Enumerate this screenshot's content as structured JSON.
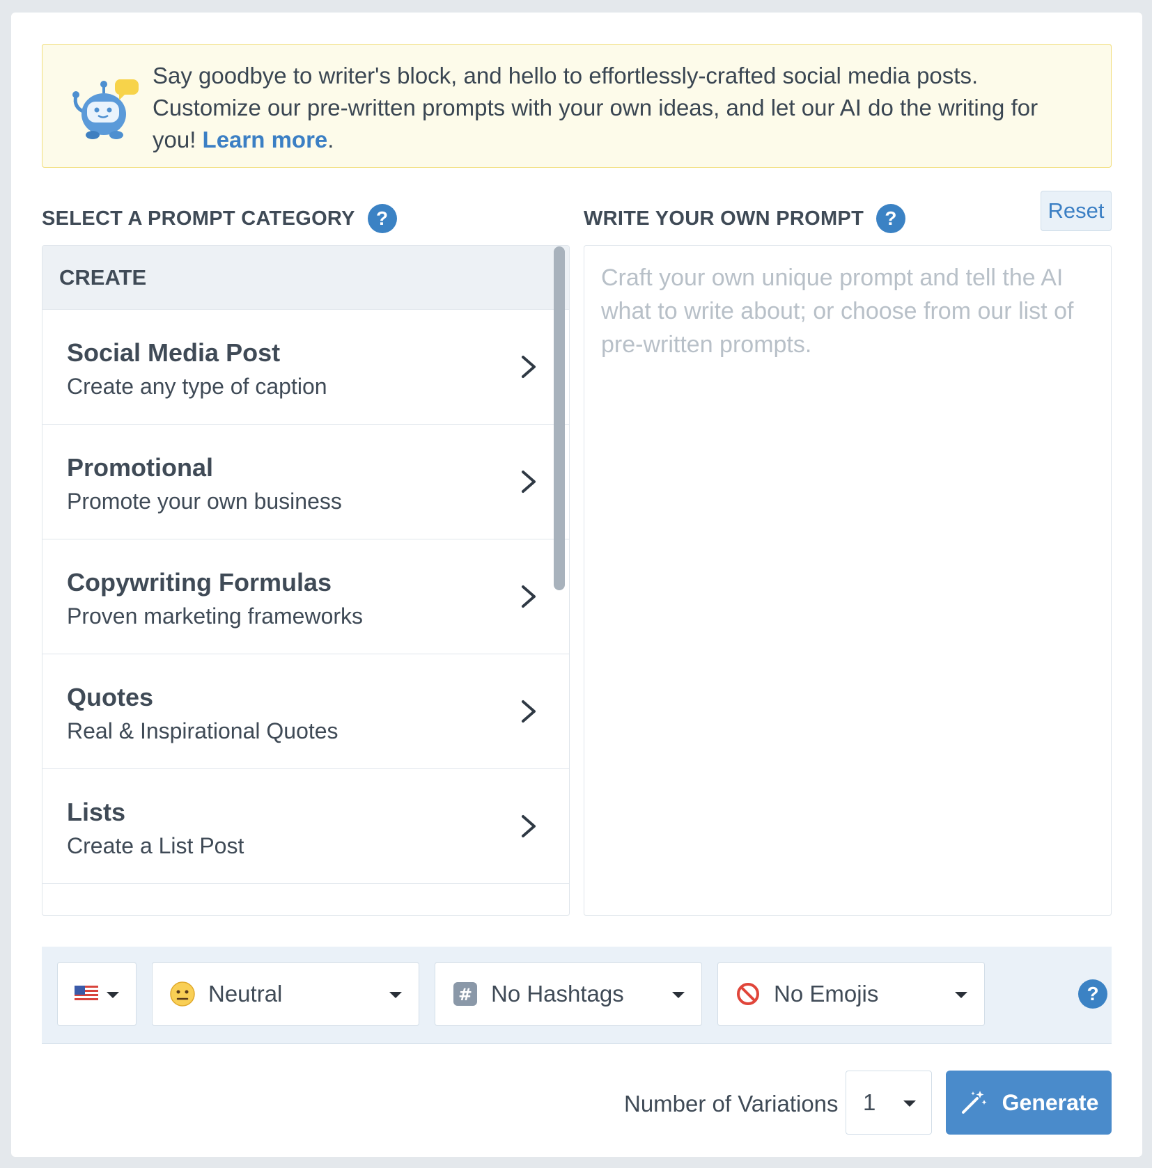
{
  "banner": {
    "text": "Say goodbye to writer's block, and hello to effortlessly-crafted social media posts. Customize our pre-written prompts with your own ideas, and let our AI do the writing for you! ",
    "link_label": "Learn more",
    "suffix": ".",
    "icon": "robot-icon"
  },
  "category_section": {
    "title": "SELECT A PROMPT CATEGORY",
    "help": "?"
  },
  "prompt_section": {
    "title": "WRITE YOUR OWN PROMPT",
    "help": "?",
    "reset_label": "Reset",
    "placeholder": "Craft your own unique prompt and tell the AI what to write about; or choose from our list of pre-written prompts."
  },
  "categories": {
    "group_label": "CREATE",
    "items": [
      {
        "title": "Social Media Post",
        "subtitle": "Create any type of caption"
      },
      {
        "title": "Promotional",
        "subtitle": "Promote your own business"
      },
      {
        "title": "Copywriting Formulas",
        "subtitle": "Proven marketing frameworks"
      },
      {
        "title": "Quotes",
        "subtitle": "Real & Inspirational Quotes"
      },
      {
        "title": "Lists",
        "subtitle": "Create a List Post"
      }
    ]
  },
  "options": {
    "language": {
      "icon": "us-flag-icon"
    },
    "tone": {
      "label": "Neutral",
      "icon": "neutral-face-icon"
    },
    "hashtags": {
      "label": "No Hashtags",
      "icon": "hashtag-icon"
    },
    "emojis": {
      "label": "No Emojis",
      "icon": "prohibited-icon"
    },
    "help": "?"
  },
  "footer": {
    "variations_label": "Number of Variations",
    "variations_value": "1",
    "generate_label": "Generate",
    "generate_icon": "magic-wand-icon"
  },
  "colors": {
    "accent": "#3b82c4",
    "banner_bg": "#fdfbea",
    "banner_border": "#f1dd7a",
    "generate_bg": "#4a8bcb"
  }
}
